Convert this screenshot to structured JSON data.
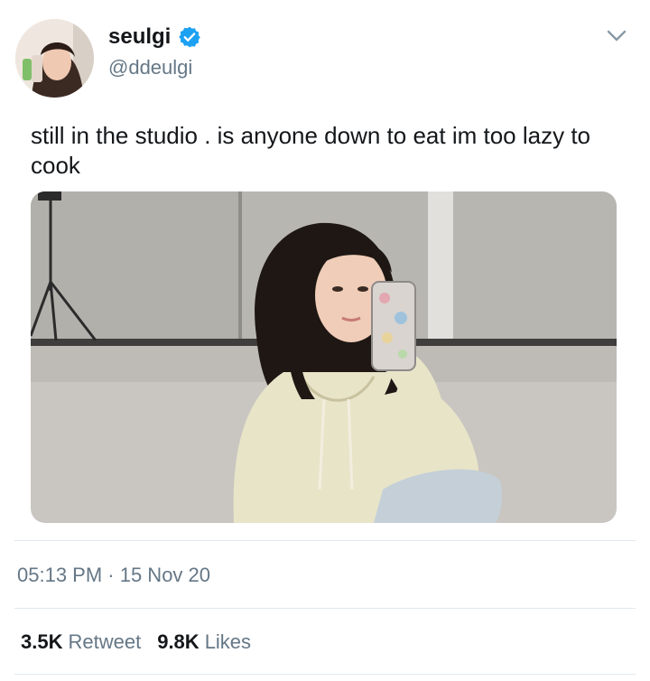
{
  "user": {
    "display_name": "seulgi",
    "handle": "@ddeulgi",
    "verified_icon": "verified-badge-icon",
    "menu_icon": "chevron-down-icon"
  },
  "tweet": {
    "text": "still in the studio . is anyone down to eat im too lazy to cook",
    "timestamp": "05:13 PM · 15 Nov 20"
  },
  "stats": {
    "retweets_count": "3.5K",
    "retweets_label": "Retweet",
    "likes_count": "9.8K",
    "likes_label": "Likes"
  },
  "colors": {
    "accent": "#1da1f2",
    "secondary_text": "#657786",
    "divider": "#e1e8ed"
  }
}
